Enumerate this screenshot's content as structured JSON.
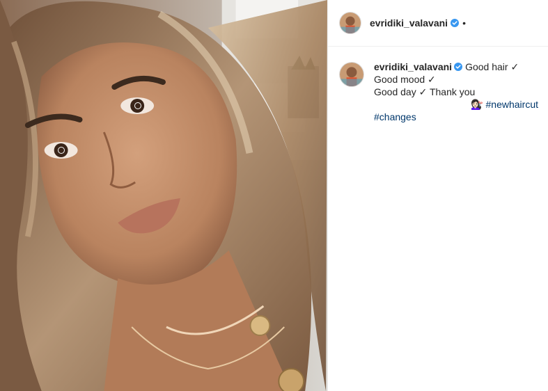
{
  "post": {
    "username": "evridiki_valavani",
    "header_separator": "•",
    "caption": {
      "first_line": "Good hair ✓",
      "line2": "Good mood ✓",
      "line3": "Good day ✓ Thank you",
      "emoji_line": "💇🏻‍♀️",
      "hashtag1": "#newhaircut",
      "hashtag2": "#changes"
    }
  },
  "colors": {
    "verified_badge": "#3897f0",
    "hashtag": "#00376b",
    "divider": "#efefef"
  },
  "icons": {
    "verified": "verified-badge-icon",
    "avatar": "profile-avatar"
  }
}
